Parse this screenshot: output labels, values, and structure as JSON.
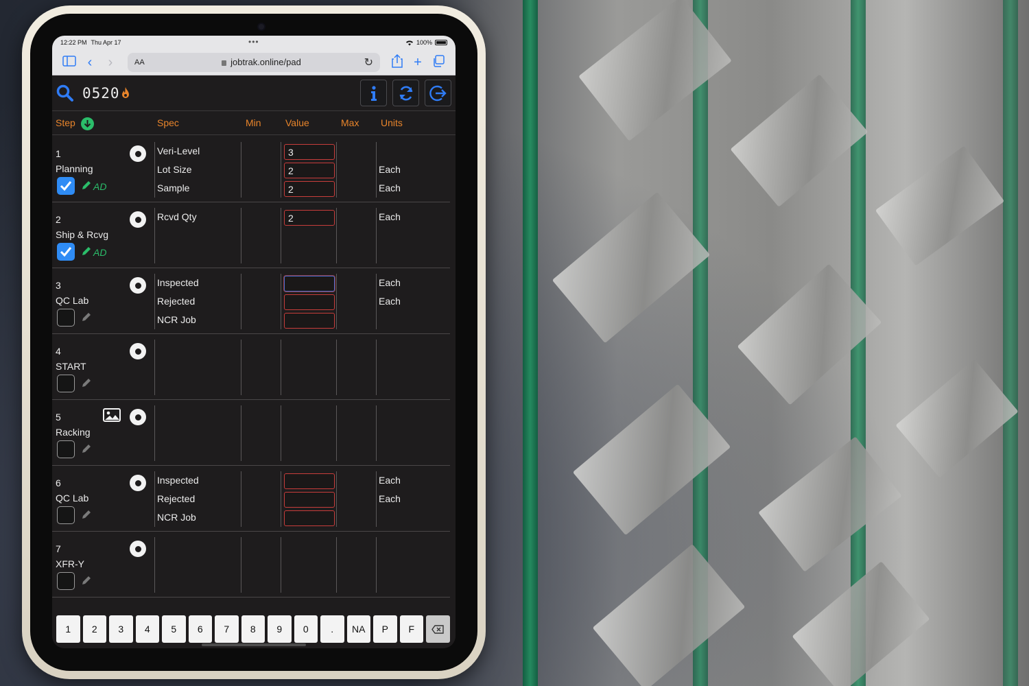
{
  "status_bar": {
    "time": "12:22 PM",
    "date": "Thu Apr 17",
    "battery": "100%",
    "dots": "•••"
  },
  "browser": {
    "aa": "AA",
    "url": "jobtrak.online/pad"
  },
  "app": {
    "job_number": "0520",
    "columns": {
      "step": "Step",
      "spec": "Spec",
      "min": "Min",
      "value": "Value",
      "max": "Max",
      "units": "Units"
    }
  },
  "steps": [
    {
      "num": "1",
      "name": "Planning",
      "checked": true,
      "initials": "AD",
      "specs": [
        "Veri-Level",
        "Lot Size",
        "Sample"
      ],
      "values": [
        "3",
        "2",
        "2"
      ],
      "units": [
        "",
        "Each",
        "Each"
      ]
    },
    {
      "num": "2",
      "name": "Ship & Rcvg",
      "checked": true,
      "initials": "AD",
      "specs": [
        "Rcvd Qty"
      ],
      "values": [
        "2"
      ],
      "units": [
        "Each"
      ]
    },
    {
      "num": "3",
      "name": "QC Lab",
      "checked": false,
      "initials": "",
      "specs": [
        "Inspected",
        "Rejected",
        "NCR Job"
      ],
      "values": [
        "",
        "",
        ""
      ],
      "units": [
        "Each",
        "Each",
        ""
      ]
    },
    {
      "num": "4",
      "name": "START",
      "checked": false,
      "initials": "",
      "specs": [],
      "values": [],
      "units": []
    },
    {
      "num": "5",
      "name": "Racking",
      "checked": false,
      "initials": "",
      "specs": [],
      "values": [],
      "units": []
    },
    {
      "num": "6",
      "name": "QC Lab",
      "checked": false,
      "initials": "",
      "specs": [
        "Inspected",
        "Rejected",
        "NCR Job"
      ],
      "values": [
        "",
        "",
        ""
      ],
      "units": [
        "Each",
        "Each",
        ""
      ]
    },
    {
      "num": "7",
      "name": "XFR-Y",
      "checked": false,
      "initials": "",
      "specs": [],
      "values": [],
      "units": []
    }
  ],
  "keypad": [
    "1",
    "2",
    "3",
    "4",
    "5",
    "6",
    "7",
    "8",
    "9",
    "0",
    ".",
    "NA",
    "P",
    "F"
  ],
  "colors": {
    "accent_orange": "#e9852b",
    "check_blue": "#2f8cf5",
    "initials_green": "#2bbd6a",
    "field_border_red": "#c83d3b",
    "icon_blue": "#2f7cf6"
  },
  "icons": [
    "search-icon",
    "flame-icon",
    "info-icon",
    "refresh-icon",
    "logout-icon",
    "check-circle-icon",
    "radio-icon",
    "pen-icon",
    "image-icon",
    "backspace-icon"
  ]
}
